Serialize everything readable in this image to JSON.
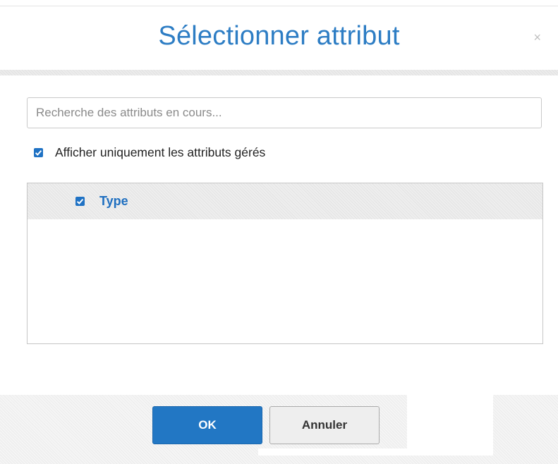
{
  "dialog": {
    "title": "Sélectionner attribut",
    "close_glyph": "×"
  },
  "search": {
    "placeholder": "Recherche des attributs en cours...",
    "value": ""
  },
  "filter": {
    "checked": true,
    "label": "Afficher uniquement les attributs gérés"
  },
  "attributes": [
    {
      "label": "Type",
      "checked": true
    }
  ],
  "buttons": {
    "ok_label": "OK",
    "cancel_label": "Annuler"
  },
  "colors": {
    "accent": "#2d7dc4",
    "checkbox": "#1f72c4",
    "ok_button": "#2277c4"
  },
  "icons": {
    "close": "close-icon",
    "check": "checkmark-icon"
  }
}
